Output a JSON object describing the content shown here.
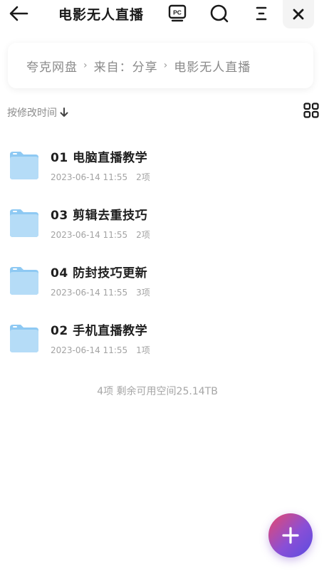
{
  "header": {
    "title": "电影无人直播",
    "icons": [
      "back-arrow-icon",
      "pc-icon",
      "search-icon",
      "menu-icon",
      "close-icon"
    ]
  },
  "breadcrumb": {
    "items": [
      "夸克网盘",
      "来自：分享",
      "电影无人直播"
    ],
    "separator": "›"
  },
  "sort": {
    "label": "按修改时间"
  },
  "files": [
    {
      "name": "01 电脑直播教学",
      "date": "2023-06-14 11:55",
      "count": "2项"
    },
    {
      "name": "03 剪辑去重技巧",
      "date": "2023-06-14 11:55",
      "count": "2项"
    },
    {
      "name": "04 防封技巧更新",
      "date": "2023-06-14 11:55",
      "count": "3项"
    },
    {
      "name": "02 手机直播教学",
      "date": "2023-06-14 11:55",
      "count": "1项"
    }
  ],
  "summary": "4项  剩余可用空间25.14TB",
  "colors": {
    "folder": "#8ec9f3",
    "folder_light": "#b5dcf7",
    "fab_start": "#e8486c",
    "fab_end": "#5a4ce0"
  }
}
